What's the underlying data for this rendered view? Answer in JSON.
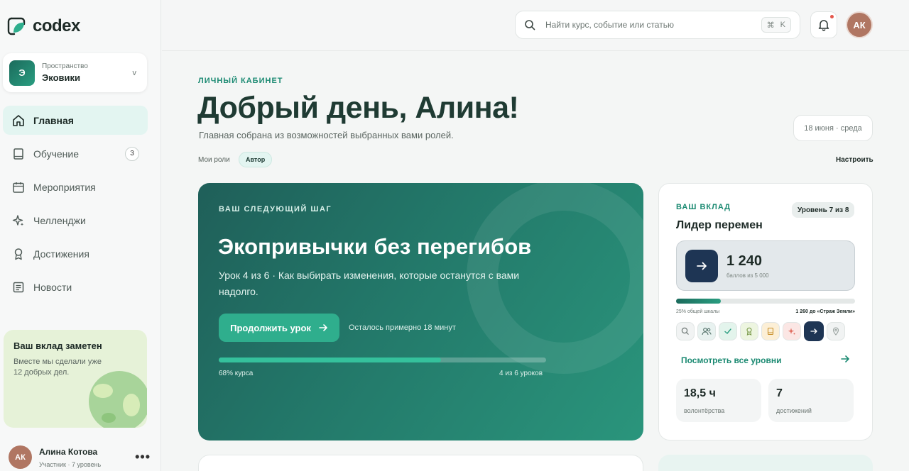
{
  "brand": {
    "name": "codex"
  },
  "workspace": {
    "label": "Пространство",
    "name": "Эковики",
    "initial": "Э",
    "chevron": "v"
  },
  "nav": [
    {
      "label": "Главная",
      "icon": "home-icon",
      "active": true
    },
    {
      "label": "Обучение",
      "icon": "book-icon",
      "badge": "3"
    },
    {
      "label": "Мероприятия",
      "icon": "calendar-icon"
    },
    {
      "label": "Челленджи",
      "icon": "sparkle-icon"
    },
    {
      "label": "Достижения",
      "icon": "award-icon"
    },
    {
      "label": "Новости",
      "icon": "newspaper-icon"
    }
  ],
  "promo": {
    "title": "Ваш вклад заметен",
    "text": "Вместе мы сделали уже 12 добрых дел."
  },
  "user": {
    "initials": "АК",
    "name": "Алина Котова",
    "subtitle": "Участник · 7 уровень",
    "more": "•••"
  },
  "search": {
    "placeholder": "Найти курс, событие или статью",
    "shortcut_symbol": "⌘",
    "shortcut_key": "K"
  },
  "topbar": {
    "avatar_initials": "АК"
  },
  "page": {
    "eyebrow": "ЛИЧНЫЙ КАБИНЕТ",
    "greeting": "Добрый день, Алина!",
    "subtitle": "Главная собрана из возможностей выбранных вами ролей.",
    "date": "18 июня · среда",
    "roles_label": "Мои роли",
    "role": "Автор",
    "configure": "Настроить"
  },
  "hero": {
    "eyebrow": "ВАШ СЛЕДУЮЩИЙ ШАГ",
    "title": "Экопривычки без перегибов",
    "description": "Урок 4 из 6 · Как выбирать изменения, которые останутся с вами надолго.",
    "button": "Продолжить урок",
    "time_left": "Осталось примерно 18 минут",
    "progress": 0.68,
    "progress_label": "68% курса",
    "lessons_label": "4 из 6 уроков"
  },
  "contribution": {
    "eyebrow": "ВАШ ВКЛАД",
    "level": "Уровень 7 из 8",
    "title": "Лидер перемен",
    "score": "1 240",
    "score_sub": "баллов из 5 000",
    "progress": 0.25,
    "progress_left": "25% общей шкалы",
    "progress_right": "1 260 до «Страж Земли»",
    "level_icons": [
      "search-icon",
      "users-icon",
      "check-icon",
      "award-icon",
      "book-icon",
      "sparkle-icon",
      "arrow-right-icon",
      "pin-icon"
    ],
    "link": "Посмотреть все уровни",
    "stats": [
      {
        "value": "18,5 ч",
        "label": "волонтёрства"
      },
      {
        "value": "7",
        "label": "достижений"
      }
    ]
  },
  "colors": {
    "accent": "#1b8a72",
    "hero_start": "#1f5f59",
    "hero_end": "#2a957c",
    "navy": "#1e3554"
  }
}
